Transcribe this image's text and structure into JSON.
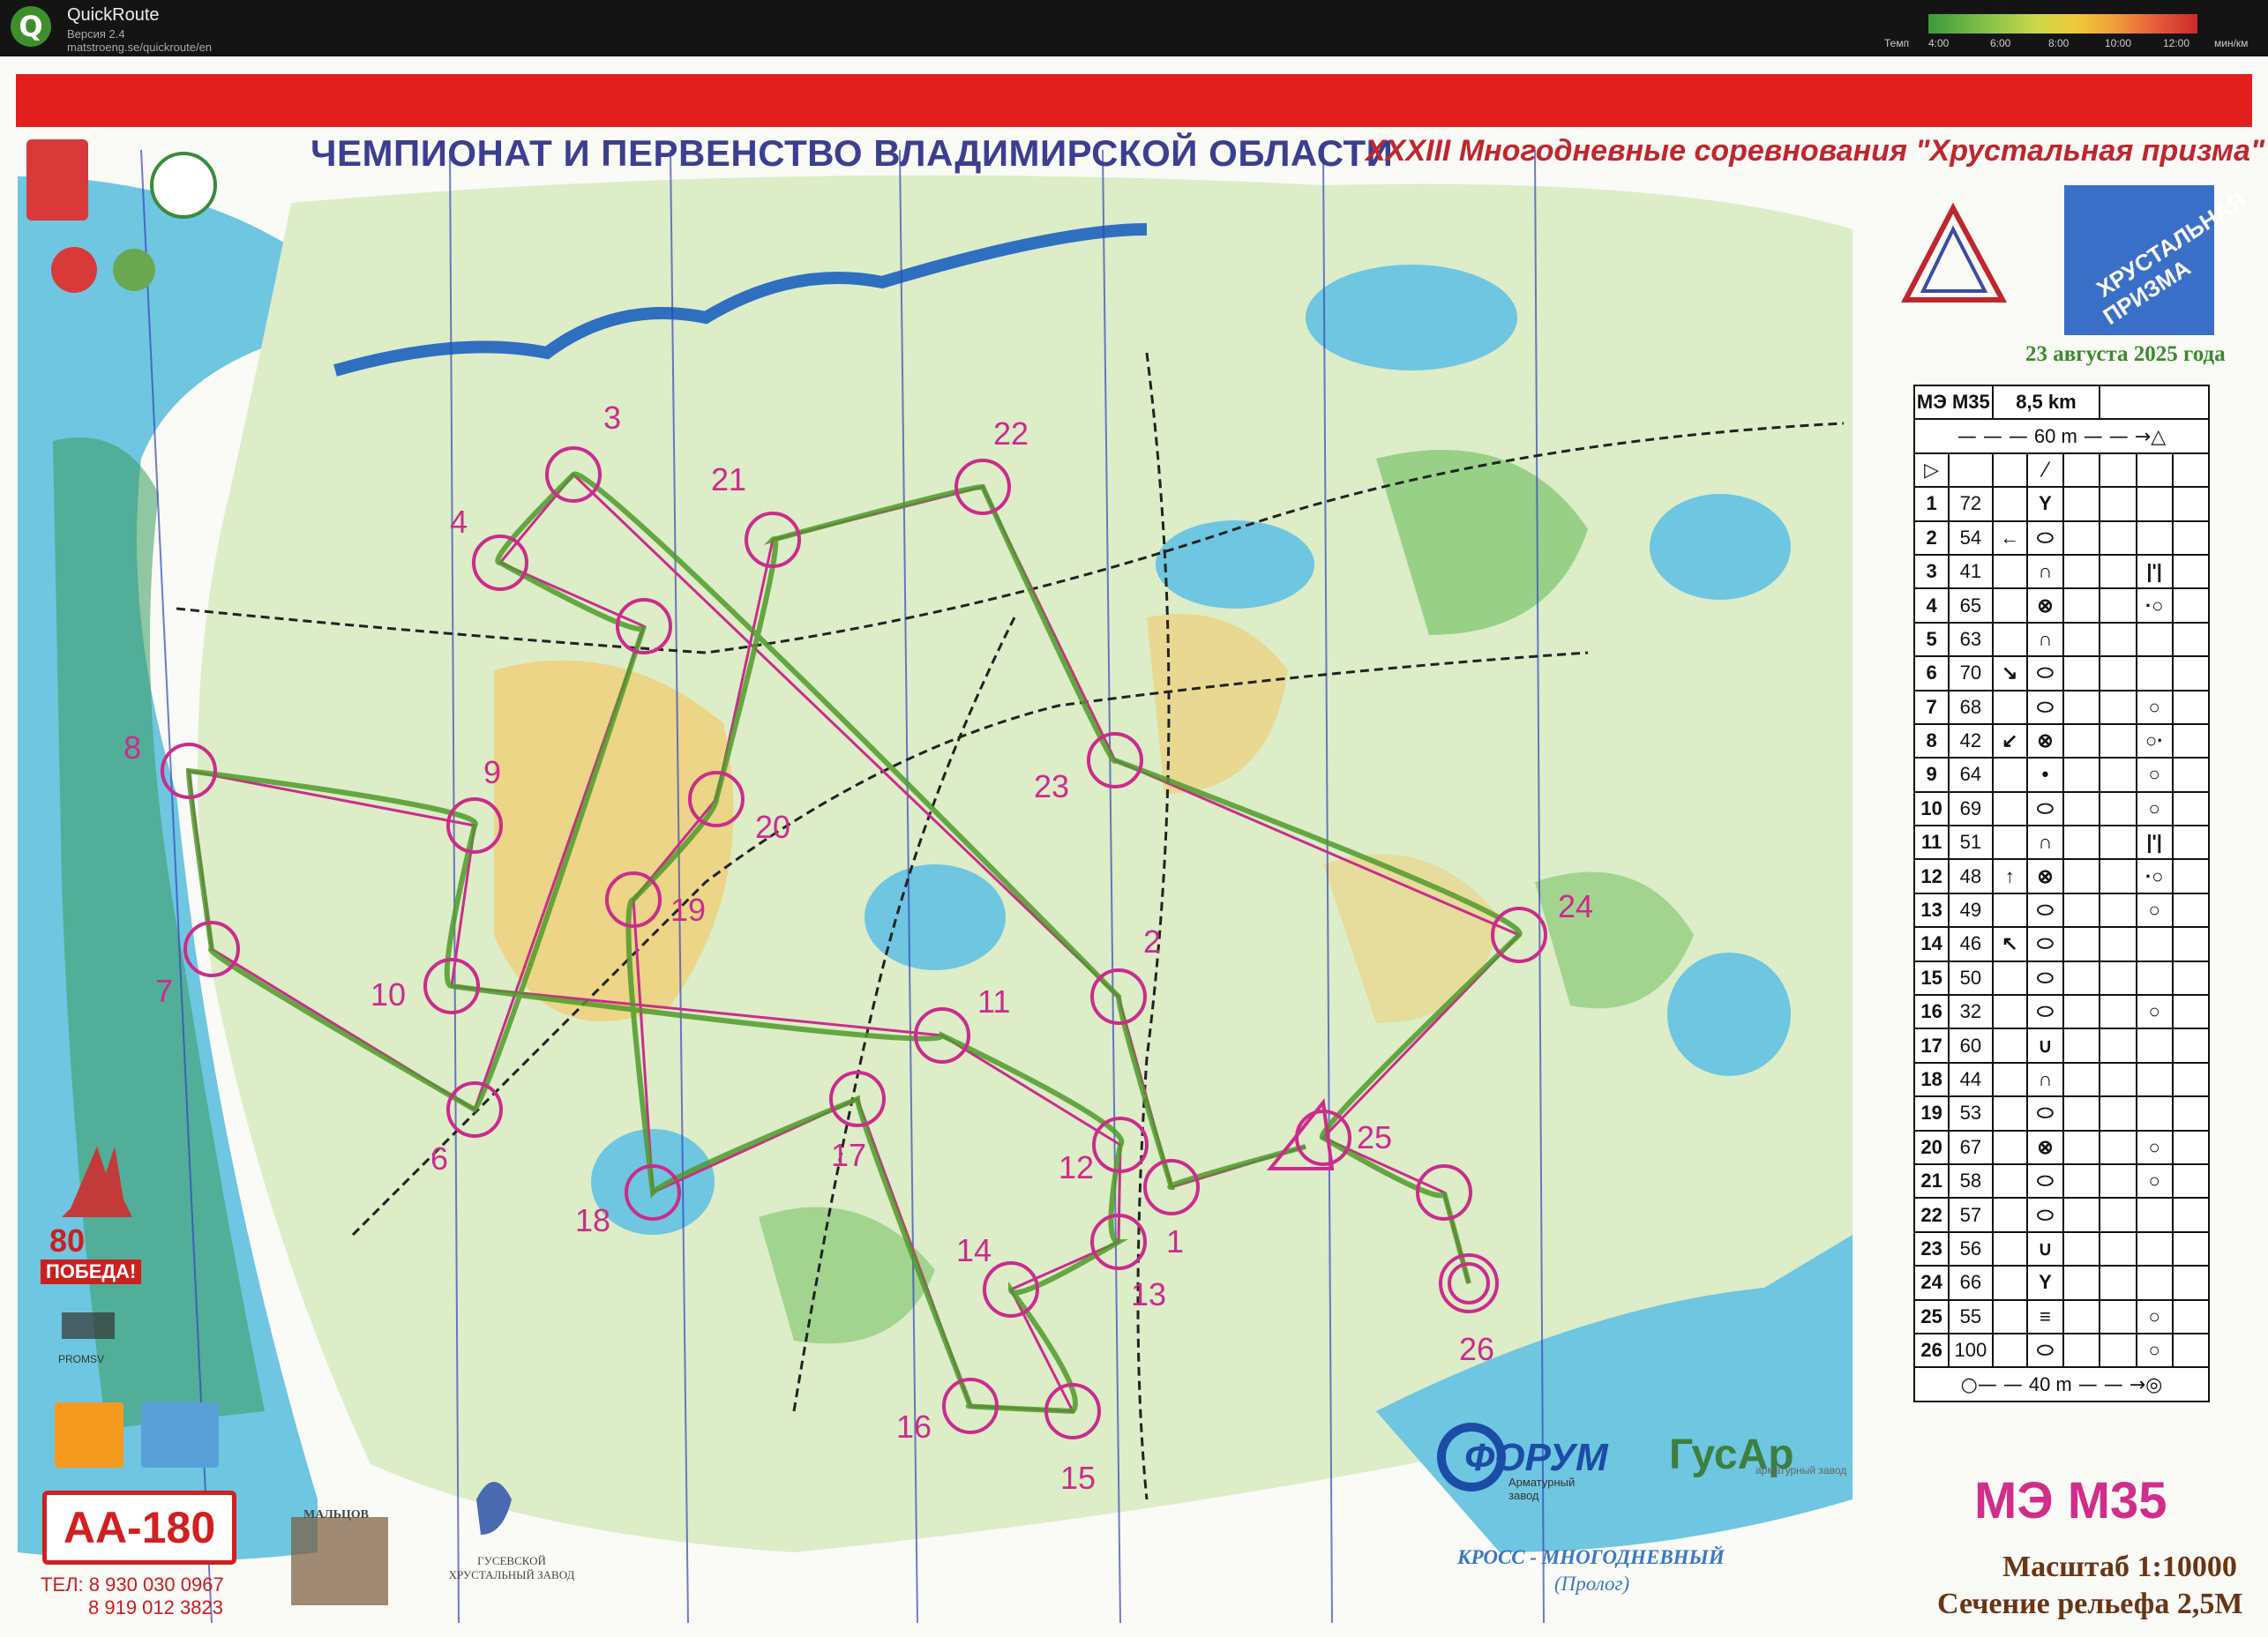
{
  "app": {
    "title": "QuickRoute",
    "version": "Версия 2.4",
    "url": "matstroeng.se/quickroute/en",
    "pace_label": "Темп",
    "pace_ticks": [
      "4:00",
      "6:00",
      "8:00",
      "10:00",
      "12:00"
    ],
    "pace_unit": "мин/км"
  },
  "map": {
    "title_left": "ЧЕМПИОНАТ И ПЕРВЕНСТВО ВЛАДИМИРСКОЙ ОБЛАСТИ",
    "title_right": "XXXIII Многодневные соревнования \"Хрустальная призма\"",
    "event_logo_line1": "ХРУСТАЛЬНАЯ",
    "event_logo_line2": "ПРИЗМА",
    "date": "23 августа 2025 года",
    "course_class": "МЭ М35",
    "class_footer": "МЭ М35",
    "scale": "Масштаб 1:10000",
    "contour": "Сечение рельефа 2,5М",
    "event_type": "КРОСС - МНОГОДНЕВНЫЙ",
    "event_subtype": "(Пролог)",
    "colors": {
      "course": "#cc2b8c",
      "route": "#4f9a2a",
      "water": "#5cc4e8",
      "header_red": "#e21f1f"
    }
  },
  "description_sheet": {
    "class": "МЭ М35",
    "length": "8,5 km",
    "start_dist": "60 m",
    "finish_dist": "40 m",
    "rows": [
      {
        "n": "1",
        "code": "72",
        "dir": "",
        "feat": "Y",
        "extra": ""
      },
      {
        "n": "2",
        "code": "54",
        "dir": "←",
        "feat": "⬭",
        "extra": ""
      },
      {
        "n": "3",
        "code": "41",
        "dir": "",
        "feat": "∩",
        "extra": "|'|"
      },
      {
        "n": "4",
        "code": "65",
        "dir": "",
        "feat": "⊗",
        "extra": "·○"
      },
      {
        "n": "5",
        "code": "63",
        "dir": "",
        "feat": "∩",
        "extra": ""
      },
      {
        "n": "6",
        "code": "70",
        "dir": "↘",
        "feat": "⬭",
        "extra": ""
      },
      {
        "n": "7",
        "code": "68",
        "dir": "",
        "feat": "⬭",
        "extra": "○"
      },
      {
        "n": "8",
        "code": "42",
        "dir": "↙",
        "feat": "⊗",
        "extra": "○·"
      },
      {
        "n": "9",
        "code": "64",
        "dir": "",
        "feat": "•",
        "extra": "○"
      },
      {
        "n": "10",
        "code": "69",
        "dir": "",
        "feat": "⬭",
        "extra": "○"
      },
      {
        "n": "11",
        "code": "51",
        "dir": "",
        "feat": "∩",
        "extra": "|'|"
      },
      {
        "n": "12",
        "code": "48",
        "dir": "↑",
        "feat": "⊗",
        "extra": "·○"
      },
      {
        "n": "13",
        "code": "49",
        "dir": "",
        "feat": "⬭",
        "extra": "○"
      },
      {
        "n": "14",
        "code": "46",
        "dir": "↖",
        "feat": "⬭",
        "extra": ""
      },
      {
        "n": "15",
        "code": "50",
        "dir": "",
        "feat": "⬭",
        "extra": ""
      },
      {
        "n": "16",
        "code": "32",
        "dir": "",
        "feat": "⬭",
        "extra": "○"
      },
      {
        "n": "17",
        "code": "60",
        "dir": "",
        "feat": "∪",
        "extra": ""
      },
      {
        "n": "18",
        "code": "44",
        "dir": "",
        "feat": "∩",
        "extra": ""
      },
      {
        "n": "19",
        "code": "53",
        "dir": "",
        "feat": "⬭",
        "extra": ""
      },
      {
        "n": "20",
        "code": "67",
        "dir": "",
        "feat": "⊗",
        "extra": "○"
      },
      {
        "n": "21",
        "code": "58",
        "dir": "",
        "feat": "⬭",
        "extra": "○"
      },
      {
        "n": "22",
        "code": "57",
        "dir": "",
        "feat": "⬭",
        "extra": ""
      },
      {
        "n": "23",
        "code": "56",
        "dir": "",
        "feat": "∪",
        "extra": ""
      },
      {
        "n": "24",
        "code": "66",
        "dir": "",
        "feat": "Y",
        "extra": ""
      },
      {
        "n": "25",
        "code": "55",
        "dir": "",
        "feat": "≡",
        "extra": "○"
      },
      {
        "n": "26",
        "code": "100",
        "dir": "",
        "feat": "⬭",
        "extra": "○"
      }
    ]
  },
  "controls": [
    "1",
    "2",
    "3",
    "4",
    "5",
    "6",
    "7",
    "8",
    "9",
    "10",
    "11",
    "12",
    "13",
    "14",
    "15",
    "16",
    "17",
    "18",
    "19",
    "20",
    "21",
    "22",
    "23",
    "24",
    "25",
    "26"
  ],
  "sponsors": {
    "forum": "ФОРУМ",
    "forum_sub": "Арматурный завод",
    "gusar": "ГусАр",
    "gusar_sub": "арматурный завод",
    "aa180": "АА-180",
    "phone1": "ТЕЛ: 8 930 030 0967",
    "phone2": "8 919 012 3823",
    "pobeda80": "80",
    "pobeda": "ПОБЕДА!",
    "promsv": "PROMSV",
    "malcov": "МАЛЬЦОВ",
    "gusev": "ГУСЕВСКОЙ ХРУСТАЛЬНЫЙ ЗАВОД"
  }
}
